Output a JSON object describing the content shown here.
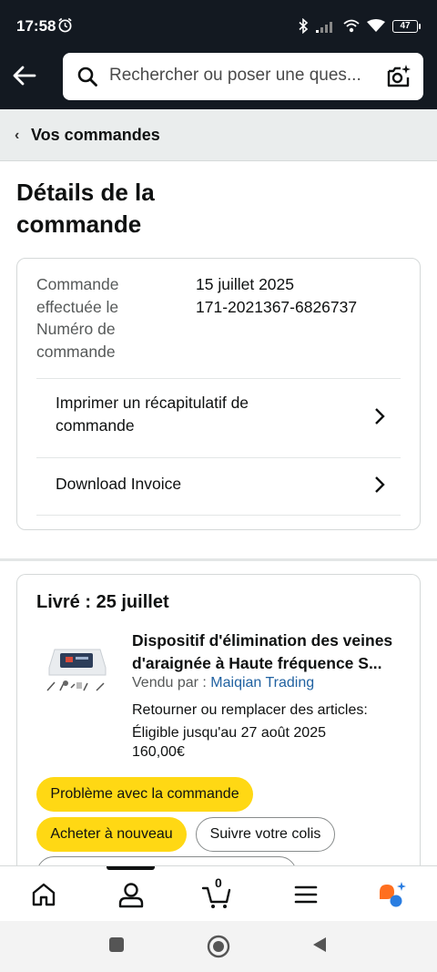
{
  "status_bar": {
    "time": "17:58",
    "battery": "47"
  },
  "search": {
    "placeholder": "Rechercher ou poser une ques..."
  },
  "breadcrumb": {
    "label": "Vos commandes"
  },
  "page": {
    "title": "Détails de la commande"
  },
  "order_info": {
    "date_label": "Commande effectuée le",
    "number_label": "Numéro de commande",
    "date_value": "15 juillet 2025",
    "number_value": "171-2021367-6826737",
    "links": [
      {
        "label": "Imprimer un récapitulatif de commande"
      },
      {
        "label": "Download Invoice"
      }
    ]
  },
  "shipment": {
    "status": "Livré : 25 juillet",
    "product": {
      "title_line1": "Dispositif d'élimination des veines",
      "title_line2": "d'araignée à Haute fréquence S...",
      "seller_prefix": "Vendu par  :",
      "seller_name": "Maiqian Trading",
      "return_line1": "Retourner ou remplacer des articles:",
      "return_line2": "Éligible jusqu'au 27 août 2025",
      "price": "160,00€"
    },
    "buttons": {
      "problem": "Problème avec la commande",
      "buy_again": "Acheter à nouveau",
      "track": "Suivre votre colis"
    }
  },
  "bottom_nav": {
    "cart_count": "0",
    "items": [
      "home-icon",
      "account-icon",
      "cart-icon",
      "menu-icon",
      "rufus-icon"
    ]
  },
  "colors": {
    "header_bg": "#131921",
    "button_yellow": "#ffd814",
    "link_blue": "#2162a1",
    "rufus_orange": "#ff6f1f",
    "rufus_blue": "#2a7de1"
  }
}
